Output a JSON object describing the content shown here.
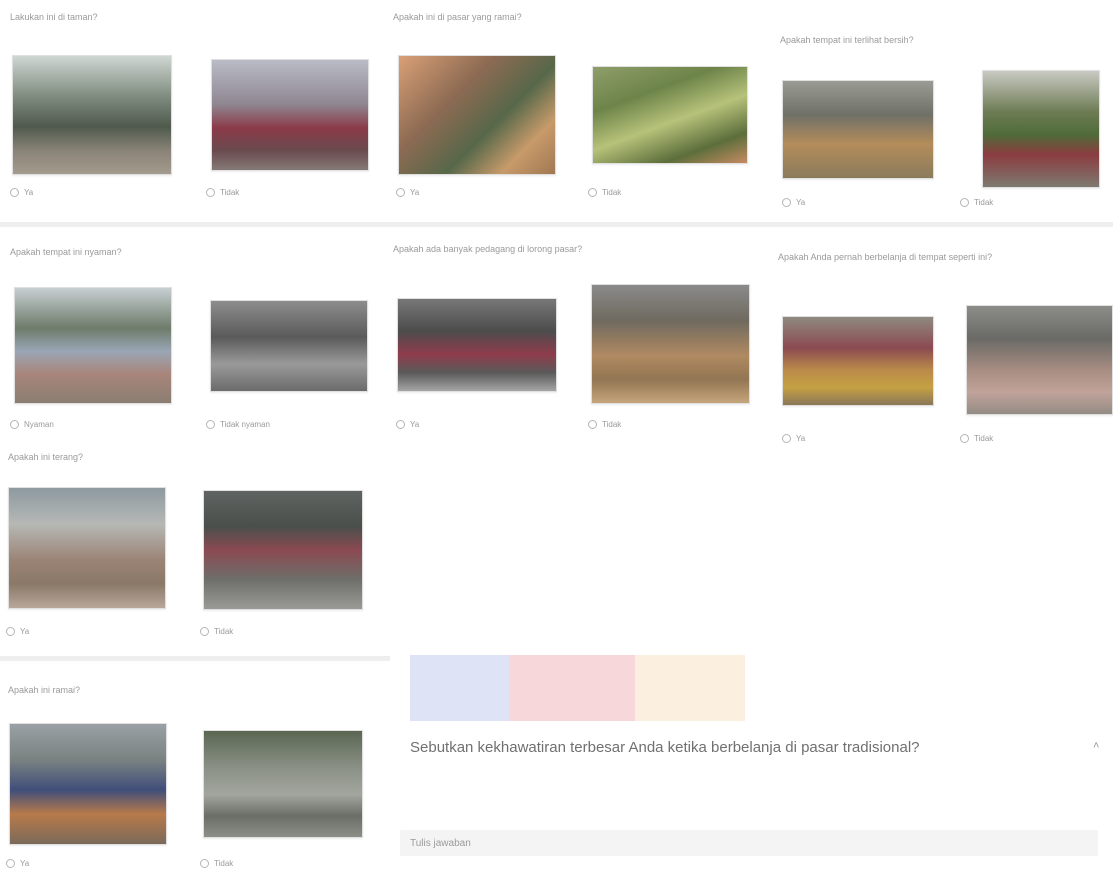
{
  "questions": [
    {
      "text": "Lakukan ini di taman?",
      "options": [
        "Ya",
        "Tidak"
      ]
    },
    {
      "text": "Apakah ini di pasar yang ramai?",
      "options": [
        "Ya",
        "Tidak"
      ]
    },
    {
      "text": "Apakah tempat ini terlihat bersih?",
      "options": [
        "Ya",
        "Tidak"
      ]
    },
    {
      "text": "Apakah tempat ini nyaman?",
      "options": [
        "Nyaman",
        "Tidak nyaman"
      ]
    },
    {
      "text": "Apakah ada banyak pedagang di lorong pasar?",
      "options": [
        "Ya",
        "Tidak"
      ]
    },
    {
      "text": "Apakah Anda pernah berbelanja di tempat seperti ini?",
      "options": [
        "Ya",
        "Tidak"
      ]
    },
    {
      "text": "Apakah ini terang?",
      "options": [
        "Ya",
        "Tidak"
      ]
    },
    {
      "text": "Apakah ini ramai?",
      "options": [
        "Ya",
        "Tidak"
      ]
    }
  ],
  "focus": {
    "question": "Sebutkan kekhawatiran terbesar Anda ketika berbelanja di pasar tradisional?",
    "placeholder": "Tulis jawaban"
  },
  "colors": {
    "strip": [
      "#dfe3f6",
      "#f8d7db",
      "#fbefe0"
    ]
  }
}
